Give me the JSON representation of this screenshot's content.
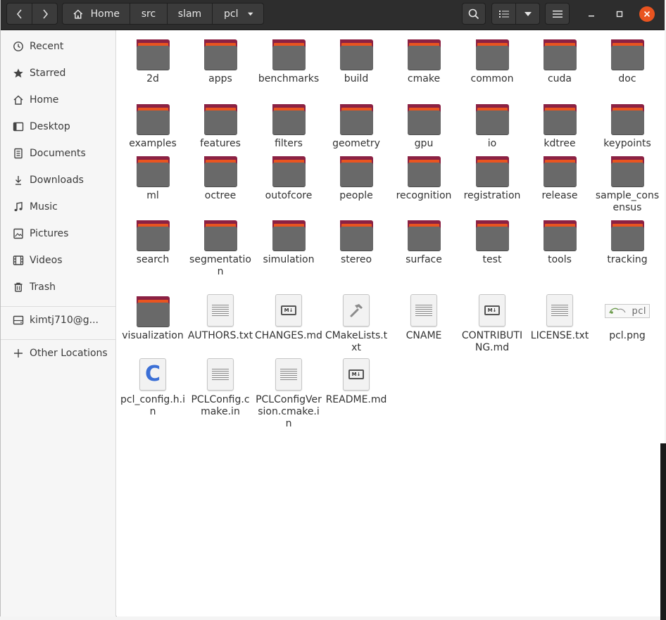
{
  "breadcrumb": [
    "Home",
    "src",
    "slam",
    "pcl"
  ],
  "sidebar": {
    "items": [
      {
        "label": "Recent",
        "icon": "clock-icon"
      },
      {
        "label": "Starred",
        "icon": "star-icon"
      },
      {
        "label": "Home",
        "icon": "home-icon"
      },
      {
        "label": "Desktop",
        "icon": "desktop-icon"
      },
      {
        "label": "Documents",
        "icon": "document-icon"
      },
      {
        "label": "Downloads",
        "icon": "download-icon"
      },
      {
        "label": "Music",
        "icon": "music-icon"
      },
      {
        "label": "Pictures",
        "icon": "picture-icon"
      },
      {
        "label": "Videos",
        "icon": "video-icon"
      },
      {
        "label": "Trash",
        "icon": "trash-icon"
      },
      {
        "label": "kimtj710@g...",
        "icon": "network-drive-icon"
      },
      {
        "label": "Other Locations",
        "icon": "plus-icon"
      }
    ]
  },
  "files": [
    {
      "name": "2d",
      "type": "folder"
    },
    {
      "name": "apps",
      "type": "folder"
    },
    {
      "name": "benchmarks",
      "type": "folder"
    },
    {
      "name": "build",
      "type": "folder"
    },
    {
      "name": "cmake",
      "type": "folder"
    },
    {
      "name": "common",
      "type": "folder"
    },
    {
      "name": "cuda",
      "type": "folder"
    },
    {
      "name": "doc",
      "type": "folder"
    },
    {
      "name": "examples",
      "type": "folder"
    },
    {
      "name": "features",
      "type": "folder"
    },
    {
      "name": "filters",
      "type": "folder"
    },
    {
      "name": "geometry",
      "type": "folder"
    },
    {
      "name": "gpu",
      "type": "folder"
    },
    {
      "name": "io",
      "type": "folder"
    },
    {
      "name": "kdtree",
      "type": "folder"
    },
    {
      "name": "keypoints",
      "type": "folder"
    },
    {
      "name": "ml",
      "type": "folder"
    },
    {
      "name": "octree",
      "type": "folder"
    },
    {
      "name": "outofcore",
      "type": "folder"
    },
    {
      "name": "people",
      "type": "folder"
    },
    {
      "name": "recognition",
      "type": "folder"
    },
    {
      "name": "registration",
      "type": "folder"
    },
    {
      "name": "release",
      "type": "folder"
    },
    {
      "name": "sample_consensus",
      "type": "folder"
    },
    {
      "name": "search",
      "type": "folder"
    },
    {
      "name": "segmentation",
      "type": "folder"
    },
    {
      "name": "simulation",
      "type": "folder"
    },
    {
      "name": "stereo",
      "type": "folder"
    },
    {
      "name": "surface",
      "type": "folder"
    },
    {
      "name": "test",
      "type": "folder"
    },
    {
      "name": "tools",
      "type": "folder"
    },
    {
      "name": "tracking",
      "type": "folder"
    },
    {
      "name": "visualization",
      "type": "folder"
    },
    {
      "name": "AUTHORS.txt",
      "type": "text"
    },
    {
      "name": "CHANGES.md",
      "type": "markdown"
    },
    {
      "name": "CMakeLists.txt",
      "type": "cmake"
    },
    {
      "name": "CNAME",
      "type": "text"
    },
    {
      "name": "CONTRIBUTING.md",
      "type": "markdown"
    },
    {
      "name": "LICENSE.txt",
      "type": "text"
    },
    {
      "name": "pcl.png",
      "type": "image",
      "thumb_text": "pcl"
    },
    {
      "name": "pcl_config.h.in",
      "type": "c-header",
      "badge": "C"
    },
    {
      "name": "PCLConfig.cmake.in",
      "type": "text"
    },
    {
      "name": "PCLConfigVersion.cmake.in",
      "type": "text"
    },
    {
      "name": "README.md",
      "type": "markdown"
    }
  ],
  "md_badge_text": "M↓",
  "colors": {
    "headerbar": "#2d2d2d",
    "folder_body": "#696969",
    "folder_back": "#8b2143",
    "folder_stripe": "#e95420",
    "close_button": "#e95420"
  }
}
